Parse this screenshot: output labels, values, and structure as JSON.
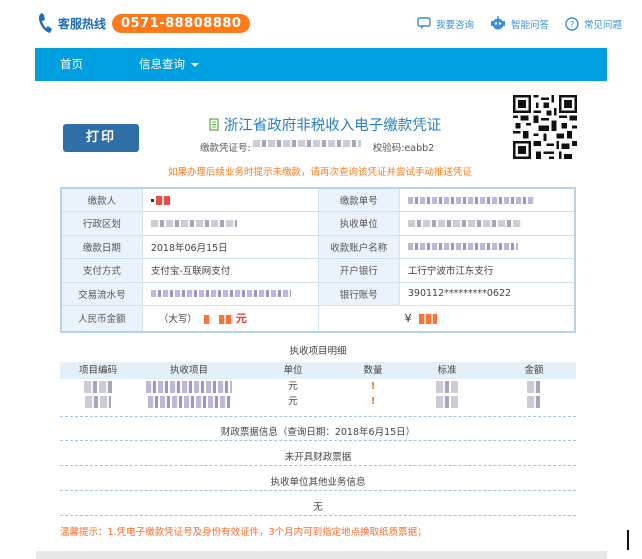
{
  "header": {
    "hotline_label": "客服热线",
    "hotline_number": "0571-88808880",
    "links": [
      {
        "label": "我要咨询",
        "icon": "chat-bubble-icon"
      },
      {
        "label": "智能问答",
        "icon": "robot-icon"
      },
      {
        "label": "常见问题",
        "icon": "question-circle-icon"
      }
    ]
  },
  "nav": {
    "home": "首页",
    "info_query": "信息查询"
  },
  "voucher": {
    "print_label": "打印",
    "title": "浙江省政府非税收入电子缴款凭证",
    "cert_no_label": "缴款凭证号:",
    "check_code": "校验码:eabb2",
    "notice": "如果办理后续业务时提示未缴款，请再次查询该凭证并尝试手动推送凭证"
  },
  "info_rows": [
    {
      "k1": "缴款人",
      "v1": "",
      "k2": "缴款单号",
      "v2": ""
    },
    {
      "k1": "行政区划",
      "v1": "",
      "k2": "执收单位",
      "v2": ""
    },
    {
      "k1": "缴款日期",
      "v1": "2018年06月15日",
      "k2": "收款账户名称",
      "v2": ""
    },
    {
      "k1": "支付方式",
      "v1": "支付宝-互联网支付",
      "k2": "开户银行",
      "v2": "工行宁波市江东支行"
    },
    {
      "k1": "交易流水号",
      "v1": "",
      "k2": "银行账号",
      "v2": "390112*********0622"
    }
  ],
  "amount": {
    "label": "人民币金额",
    "daxie_label": "（大写）",
    "unit": "元",
    "yen": "¥"
  },
  "items": {
    "section_title": "执收项目明细",
    "headers": [
      "项目编码",
      "执收项目",
      "单位",
      "数量",
      "标准",
      "金额"
    ],
    "rows": [
      {
        "unit": "元",
        "qty": "!"
      },
      {
        "unit": "元",
        "qty": "!"
      }
    ]
  },
  "finance": {
    "title": "财政票据信息（查询日期：2018年6月15日）",
    "status": "未开具财政票据"
  },
  "other": {
    "title": "执收单位其他业务信息",
    "value": "无"
  },
  "tip": "温馨提示：1.凭电子缴款凭证号及身份有效证件，3个月内可到指定地点换取纸质票据；",
  "colors": {
    "nav_blue": "#00a0e0",
    "brand_blue": "#2a7ec7",
    "accent_orange": "#ff7a1a",
    "button_blue": "#2f6fa6"
  }
}
